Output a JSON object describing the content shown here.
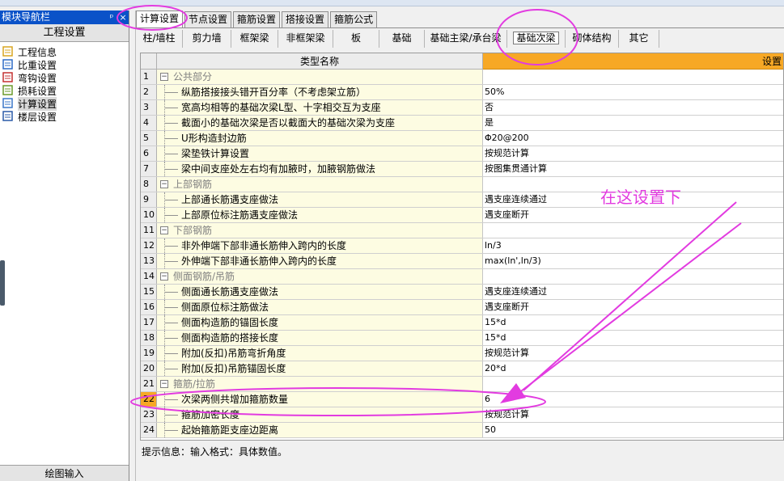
{
  "nav": {
    "title": "模块导航栏",
    "pin": "ᵖ",
    "close": "×",
    "header": "工程设置",
    "items": [
      {
        "label": "工程信息",
        "icon": "project-info-icon"
      },
      {
        "label": "比重设置",
        "icon": "weight-settings-icon"
      },
      {
        "label": "弯钩设置",
        "icon": "hook-settings-icon"
      },
      {
        "label": "损耗设置",
        "icon": "loss-settings-icon"
      },
      {
        "label": "计算设置",
        "icon": "calc-settings-icon"
      },
      {
        "label": "楼层设置",
        "icon": "floor-settings-icon"
      }
    ],
    "footer": "绘图输入"
  },
  "top_tabs": [
    "计算设置",
    "节点设置",
    "箍筋设置",
    "搭接设置",
    "箍筋公式"
  ],
  "sub_tabs": [
    "柱/墙柱",
    "剪力墙",
    "框架梁",
    "非框架梁",
    "板",
    "基础",
    "基础主梁/承台梁",
    "基础次梁",
    "砌体结构",
    "其它"
  ],
  "grid": {
    "col_name": "类型名称",
    "col_value": "设置"
  },
  "rows": [
    {
      "n": "1",
      "type": "group",
      "name": "公共部分",
      "value": ""
    },
    {
      "n": "2",
      "type": "child",
      "name": "纵筋搭接接头错开百分率（不考虑架立筋）",
      "value": "50%"
    },
    {
      "n": "3",
      "type": "child",
      "name": "宽高均相等的基础次梁L型、十字相交互为支座",
      "value": "否"
    },
    {
      "n": "4",
      "type": "child",
      "name": "截面小的基础次梁是否以截面大的基础次梁为支座",
      "value": "是"
    },
    {
      "n": "5",
      "type": "child",
      "name": "U形构造封边筋",
      "value": "Φ20@200"
    },
    {
      "n": "6",
      "type": "child",
      "name": "梁垫铁计算设置",
      "value": "按规范计算"
    },
    {
      "n": "7",
      "type": "child",
      "name": "梁中间支座处左右均有加腋时，加腋钢筋做法",
      "value": "按图集贯通计算"
    },
    {
      "n": "8",
      "type": "group",
      "name": "上部钢筋",
      "value": ""
    },
    {
      "n": "9",
      "type": "child",
      "name": "上部通长筋遇支座做法",
      "value": "遇支座连续通过"
    },
    {
      "n": "10",
      "type": "child",
      "name": "上部原位标注筋遇支座做法",
      "value": "遇支座断开"
    },
    {
      "n": "11",
      "type": "group",
      "name": "下部钢筋",
      "value": ""
    },
    {
      "n": "12",
      "type": "child",
      "name": "非外伸端下部非通长筋伸入跨内的长度",
      "value": "ln/3"
    },
    {
      "n": "13",
      "type": "child",
      "name": "外伸端下部非通长筋伸入跨内的长度",
      "value": "max(ln',ln/3)"
    },
    {
      "n": "14",
      "type": "group",
      "name": "侧面钢筋/吊筋",
      "value": ""
    },
    {
      "n": "15",
      "type": "child",
      "name": "侧面通长筋遇支座做法",
      "value": "遇支座连续通过"
    },
    {
      "n": "16",
      "type": "child",
      "name": "侧面原位标注筋做法",
      "value": "遇支座断开"
    },
    {
      "n": "17",
      "type": "child",
      "name": "侧面构造筋的锚固长度",
      "value": "15*d"
    },
    {
      "n": "18",
      "type": "child",
      "name": "侧面构造筋的搭接长度",
      "value": "15*d"
    },
    {
      "n": "19",
      "type": "child",
      "name": "附加(反扣)吊筋弯折角度",
      "value": "按规范计算"
    },
    {
      "n": "20",
      "type": "child",
      "name": "附加(反扣)吊筋锚固长度",
      "value": "20*d"
    },
    {
      "n": "21",
      "type": "group",
      "name": "箍筋/拉筋",
      "value": ""
    },
    {
      "n": "22",
      "type": "child",
      "name": "次梁两侧共增加箍筋数量",
      "value": "6",
      "highlight": true
    },
    {
      "n": "23",
      "type": "child",
      "name": "箍筋加密长度",
      "value": "按规范计算"
    },
    {
      "n": "24",
      "type": "child",
      "name": "起始箍筋距支座边距离",
      "value": "50"
    }
  ],
  "hint": "提示信息：输入格式：具体数值。",
  "annotation": {
    "text": "在这设置下",
    "color": "#e23be0"
  }
}
